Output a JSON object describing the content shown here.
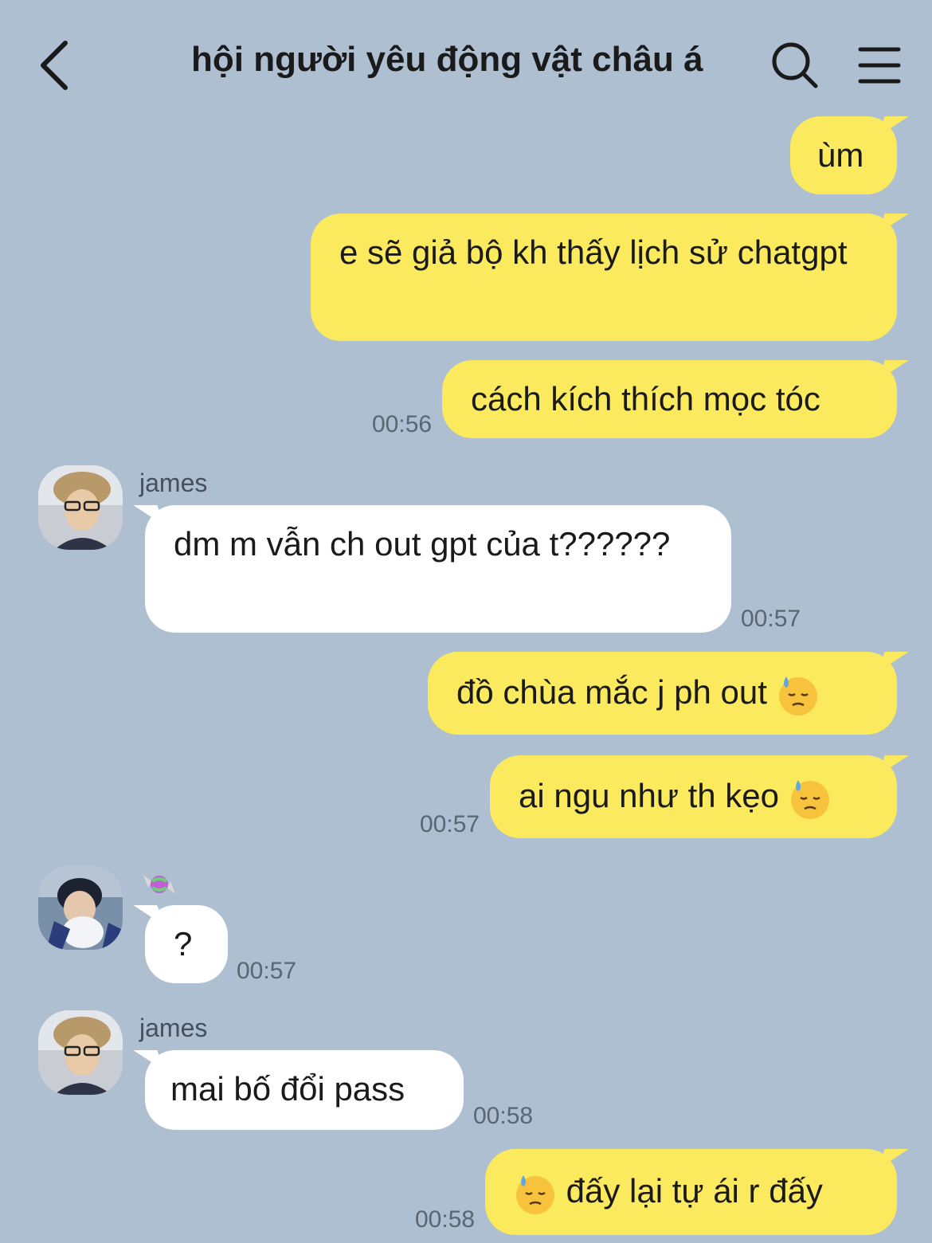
{
  "header": {
    "title": "hội người yêu động vật châu á"
  },
  "messages": [
    {
      "side": "me",
      "text": "ùm"
    },
    {
      "side": "me",
      "text": "e sẽ giả bộ kh thấy lịch sử chatgpt"
    },
    {
      "side": "me",
      "text": "cách kích thích mọc tóc",
      "time": "00:56"
    },
    {
      "side": "them",
      "sender": "james",
      "text": "dm m vẫn ch out gpt của t??????",
      "time": "00:57"
    },
    {
      "side": "me",
      "text": "đồ chùa mắc j ph out"
    },
    {
      "side": "me",
      "text": "ai ngu như th kẹo",
      "time": "00:57"
    },
    {
      "side": "them",
      "sender": "🍬",
      "text": "?",
      "time": "00:57"
    },
    {
      "side": "them",
      "sender": "james",
      "text": "mai bố đổi pass",
      "time": "00:58"
    },
    {
      "side": "me",
      "text": "đấy lại tự ái r đấy",
      "time": "00:58"
    }
  ]
}
